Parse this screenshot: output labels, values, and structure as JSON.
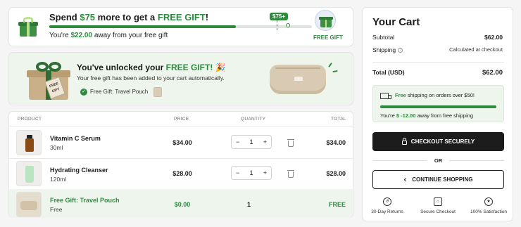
{
  "progress": {
    "title_pre": "Spend ",
    "title_amount": "$75",
    "title_mid": " more to get a ",
    "title_gift": "FREE GIFT",
    "title_end": "!",
    "sub_pre": "You're ",
    "sub_amount": "$22.00",
    "sub_post": " away from your free gift",
    "marker_label": "$75+",
    "fill_fraction": 0.71,
    "end_label": "FREE GIFT"
  },
  "unlock": {
    "title_pre": "You've unlocked your ",
    "title_gift": "FREE GIFT!",
    "title_emoji": "🎉",
    "subtitle": "Your free gift has been added to your cart automatically.",
    "chip_label": "Free Gift: Travel Pouch",
    "tag_text": "FREE GIFT"
  },
  "table": {
    "headers": {
      "product": "PRODUCT",
      "price": "PRICE",
      "quantity": "QUANTITY",
      "total": "TOTAL"
    },
    "rows": [
      {
        "name": "Vitamin C Serum",
        "variant": "30ml",
        "price": "$34.00",
        "qty": "1",
        "total": "$34.00"
      },
      {
        "name": "Hydrating Cleanser",
        "variant": "120ml",
        "price": "$28.00",
        "qty": "1",
        "total": "$28.00"
      }
    ],
    "gift_row": {
      "name": "Free Gift: Travel Pouch",
      "variant": "Free",
      "price": "$0.00",
      "qty": "1",
      "total": "FREE"
    },
    "qty_minus": "−",
    "qty_plus": "+"
  },
  "cart": {
    "title": "Your Cart",
    "subtotal_label": "Subtotal",
    "subtotal_value": "$62.00",
    "shipping_label": "Shipping",
    "shipping_value": "Calculated at checkout",
    "total_label": "Total (USD)",
    "total_value": "$62.00",
    "ship_free": "Free",
    "ship_rest": " shipping on orders over $50!",
    "ship_fill_fraction": 1.0,
    "away_pre": "You're ",
    "away_amount": "$ -12.00",
    "away_post": " away from free shipping",
    "checkout_label": "CHECKOUT SECURELY",
    "or_label": "OR",
    "continue_label": "CONTINUE SHOPPING",
    "trust": [
      {
        "label": "30-Day Returns",
        "icon": "return-icon"
      },
      {
        "label": "Secure Checkout",
        "icon": "lock-icon"
      },
      {
        "label": "100% Satisfaction",
        "icon": "badge-icon"
      }
    ]
  },
  "colors": {
    "accent": "#2e8b3e",
    "dark_button": "#1c1c1c",
    "tint": "#eef5ec"
  }
}
